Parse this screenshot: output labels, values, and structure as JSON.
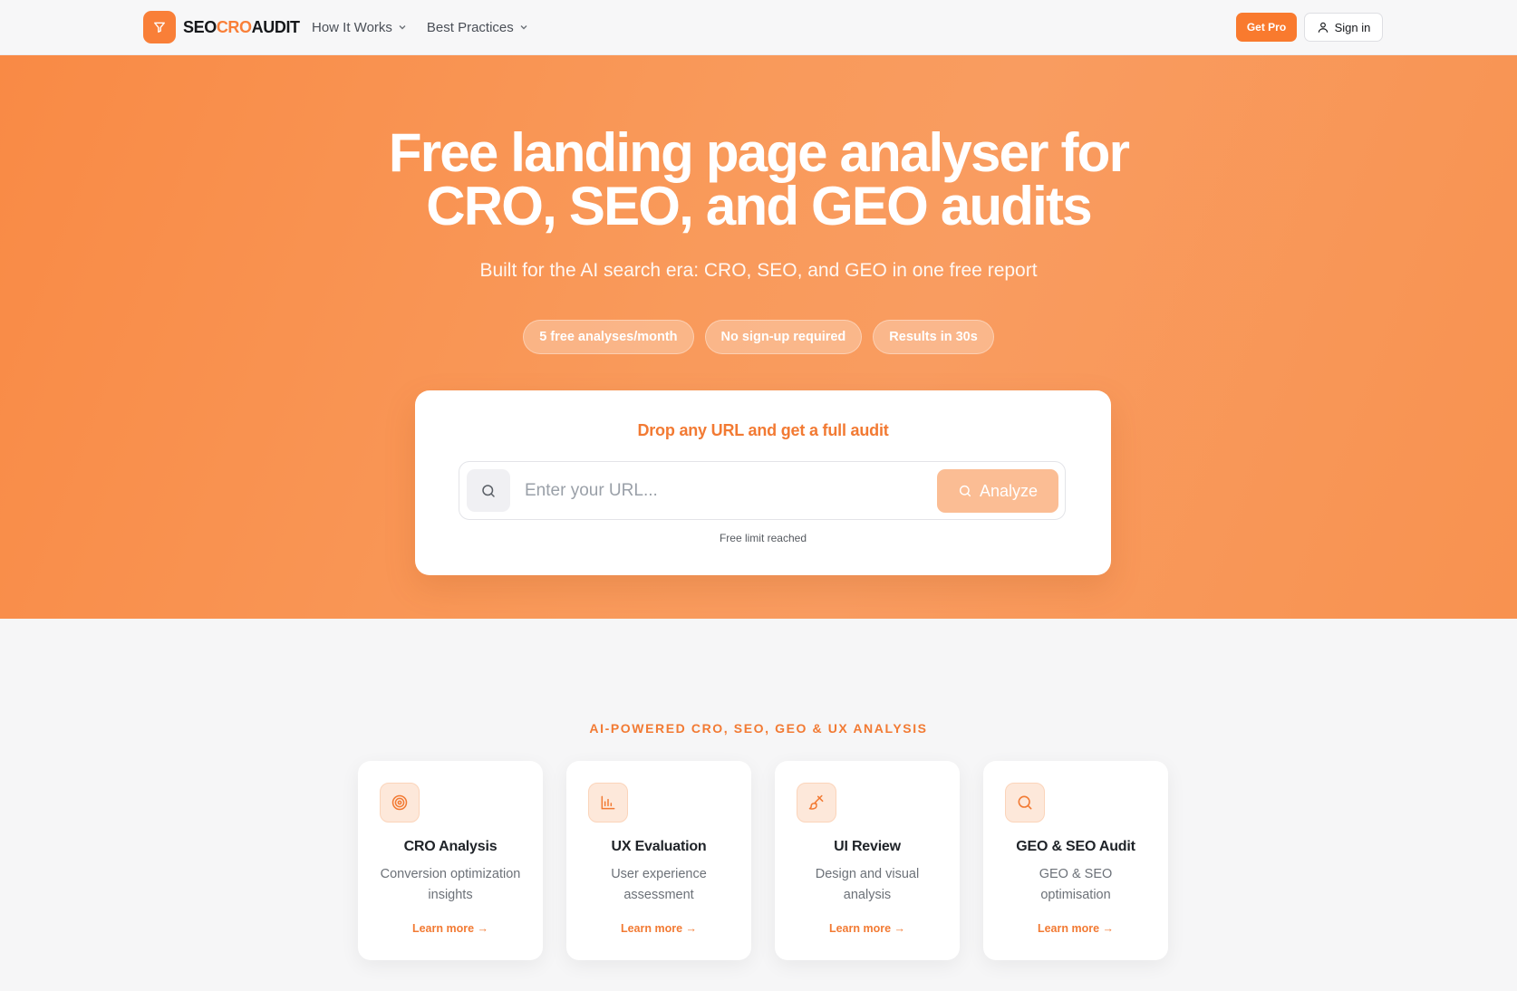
{
  "header": {
    "logo_icon": "funnel-icon",
    "logo": {
      "part1": "SEO",
      "part2": "CRO",
      "part3": "AUDIT"
    },
    "nav": [
      {
        "label": "How It Works",
        "icon": "chevron-down-icon"
      },
      {
        "label": "Best Practices",
        "icon": "chevron-down-icon"
      }
    ],
    "get_pro": "Get Pro",
    "sign_in": "Sign in",
    "sign_in_icon": "user-icon"
  },
  "hero": {
    "title_line1": "Free landing page analyser for",
    "title_line2": "CRO, SEO, and GEO audits",
    "subtitle": "Built for the AI search era: CRO, SEO, and GEO in one free report",
    "pills": [
      "5 free analyses/month",
      "No sign-up required",
      "Results in 30s"
    ]
  },
  "audit_card": {
    "title": "Drop any URL and get a full audit",
    "input_placeholder": "Enter your URL...",
    "input_value": "",
    "search_icon": "search-icon",
    "analyze_label": "Analyze",
    "note": "Free limit reached"
  },
  "features": {
    "heading": "AI-POWERED CRO, SEO, GEO & UX ANALYSIS",
    "cards": [
      {
        "icon": "target-icon",
        "title": "CRO Analysis",
        "description": "Conversion optimization insights",
        "link": "Learn more →"
      },
      {
        "icon": "bar-chart-icon",
        "title": "UX Evaluation",
        "description": "User experience assessment",
        "link": "Learn more →"
      },
      {
        "icon": "paintbrush-icon",
        "title": "UI Review",
        "description": "Design and visual analysis",
        "link": "Learn more →"
      },
      {
        "icon": "search-icon",
        "title": "GEO & SEO Audit",
        "description": "GEO & SEO optimisation",
        "link": "Learn more →"
      }
    ]
  },
  "colors": {
    "accent": "#f97f38",
    "hero_gradient_start": "#f98a45",
    "hero_gradient_end": "#f99c60",
    "analyze_disabled": "#fbbd94"
  }
}
